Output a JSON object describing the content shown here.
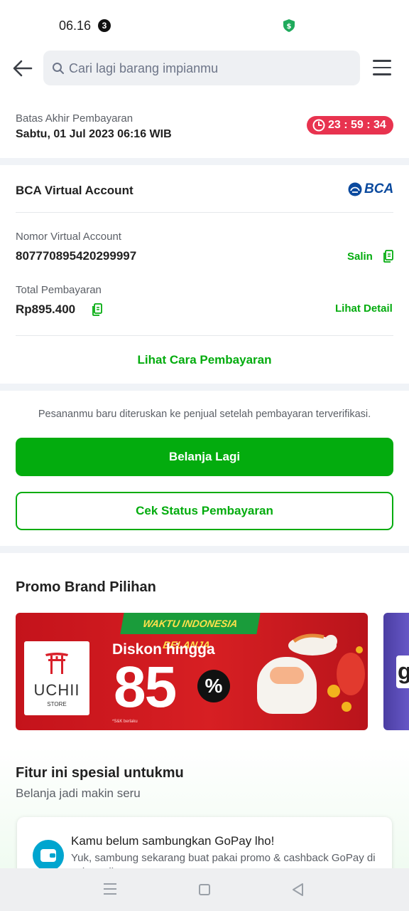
{
  "status_bar": {
    "time": "06.16",
    "notification_count": "3"
  },
  "header": {
    "search_placeholder": "Cari lagi barang impianmu"
  },
  "deadline": {
    "label": "Batas Akhir Pembayaran",
    "date": "Sabtu, 01 Jul 2023 06:16 WIB",
    "countdown": "23 : 59 : 34"
  },
  "payment": {
    "method": "BCA Virtual Account",
    "bank_logo_text": "BCA",
    "va_label": "Nomor Virtual Account",
    "va_number": "807770895420299997",
    "copy_label": "Salin",
    "total_label": "Total Pembayaran",
    "total_amount": "Rp895.400",
    "detail_link": "Lihat Detail",
    "how_to_pay": "Lihat Cara Pembayaran"
  },
  "actions": {
    "info": "Pesananmu baru diteruskan ke penjual setelah pembayaran terverifikasi.",
    "shop_again": "Belanja Lagi",
    "check_status": "Cek Status Pembayaran"
  },
  "promo": {
    "title": "Promo Brand Pilihan",
    "banner": {
      "tag": "WAKTU INDONESIA BELANJA",
      "brand": "UCHII",
      "brand_sub": "STORE",
      "headline": "Diskon hingga",
      "discount": "85",
      "percent": "%",
      "note": "*S&K berlaku"
    },
    "next_banner_letter": "g"
  },
  "special": {
    "title": "Fitur ini spesial untukmu",
    "subtitle": "Belanja jadi makin seru",
    "gopay_title": "Kamu belum sambungkan GoPay lho!",
    "gopay_desc": "Yuk, sambung sekarang buat pakai promo & cashback GoPay di Tokopedia."
  },
  "colors": {
    "brand_green": "#03ac0e",
    "timer_red": "#e8334f",
    "bca_blue": "#0b4a9e"
  }
}
